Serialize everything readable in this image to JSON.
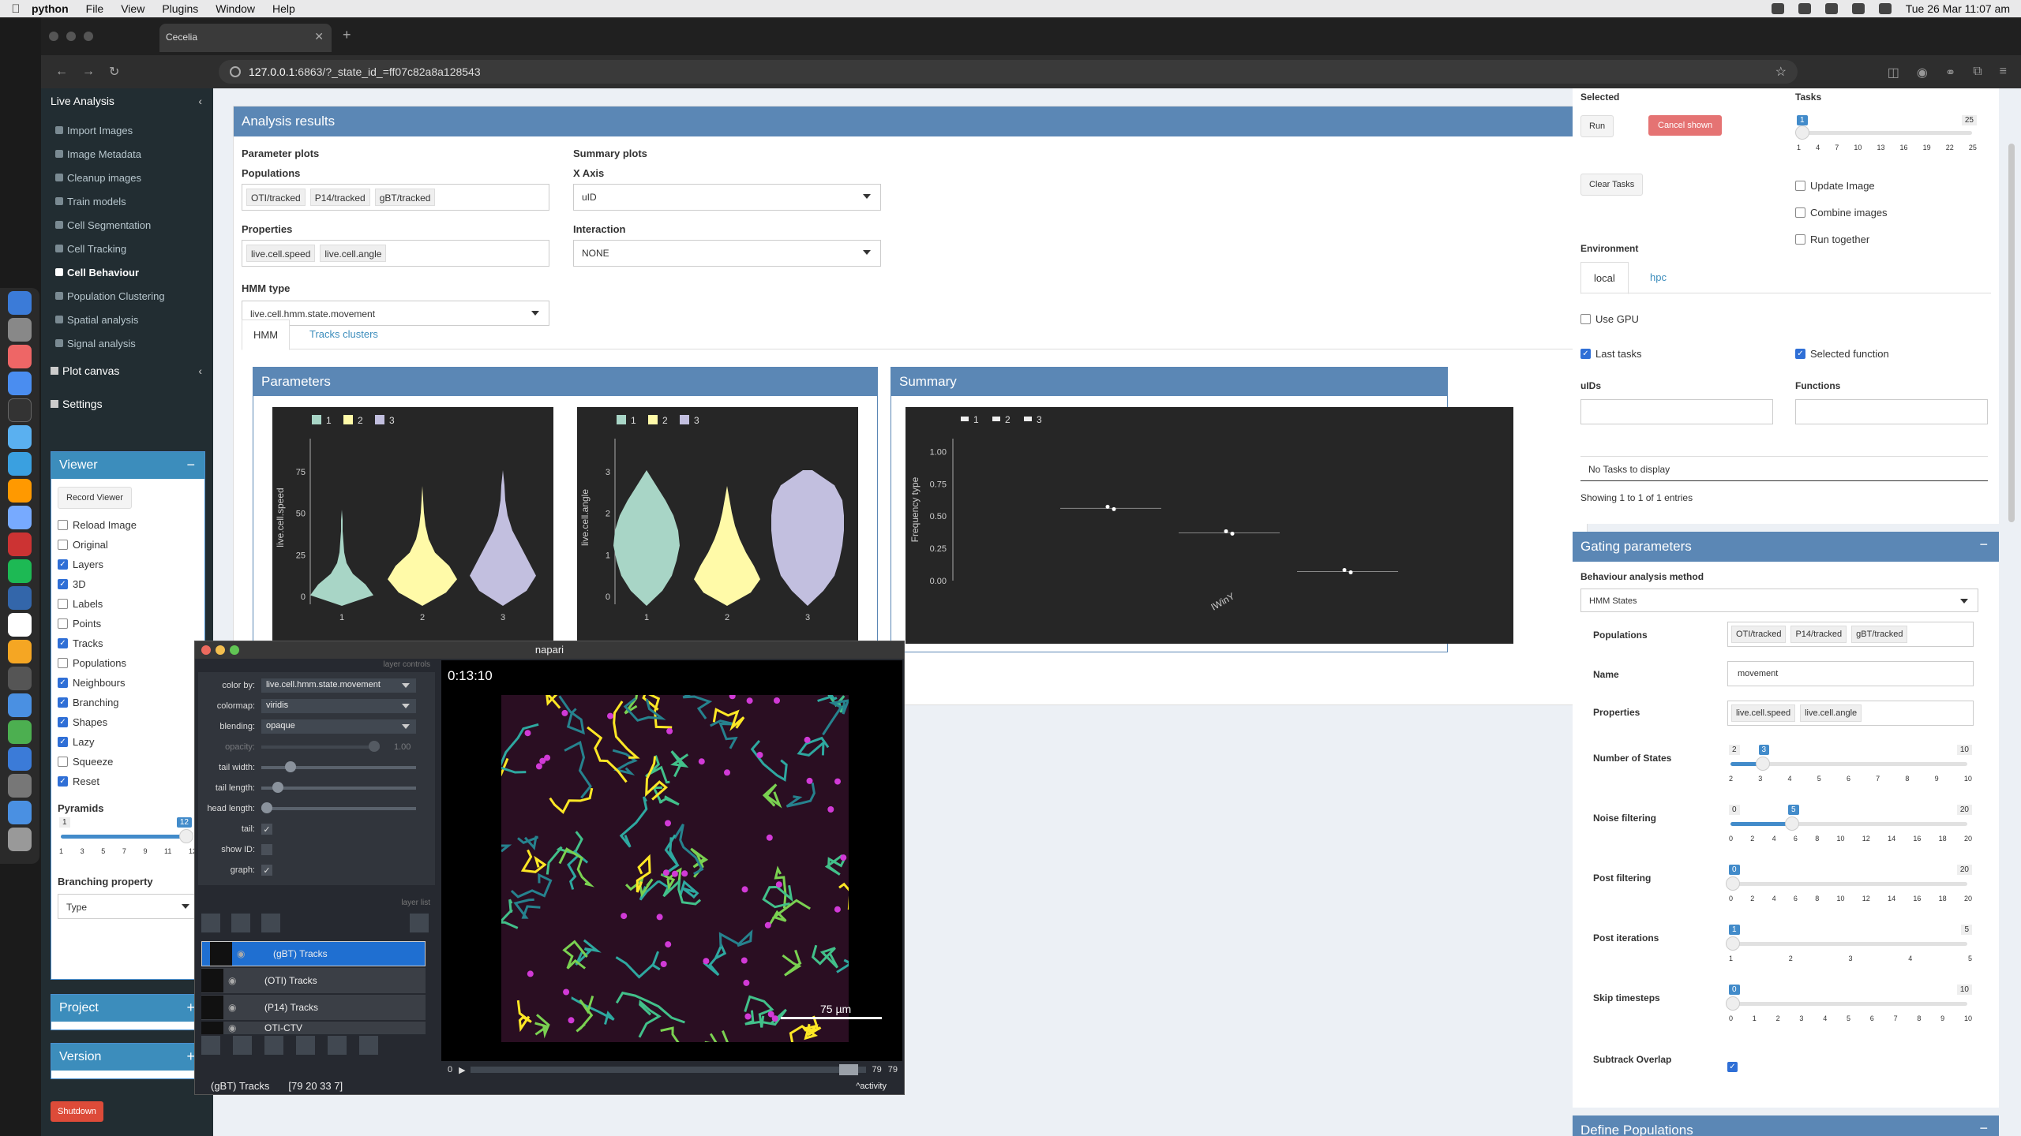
{
  "menubar": {
    "app": "python",
    "items": [
      "File",
      "View",
      "Plugins",
      "Window",
      "Help"
    ],
    "clock": "Tue 26 Mar  11:07 am"
  },
  "browser": {
    "tab_title": "Cecelia",
    "url_host": "127.0.0.1",
    "url_rest": ":6863/?_state_id_=ff07c82a8a128543"
  },
  "sidebar": {
    "live_analysis": "Live Analysis",
    "items": [
      "Import Images",
      "Image Metadata",
      "Cleanup images",
      "Train models",
      "Cell Segmentation",
      "Cell Tracking",
      "Cell Behaviour",
      "Population Clustering",
      "Spatial analysis",
      "Signal analysis"
    ],
    "plot_canvas": "Plot canvas",
    "settings": "Settings"
  },
  "viewer": {
    "title": "Viewer",
    "record": "Record Viewer",
    "options": [
      {
        "label": "Reload Image",
        "on": false
      },
      {
        "label": "Original",
        "on": false
      },
      {
        "label": "Layers",
        "on": true
      },
      {
        "label": "3D",
        "on": true
      },
      {
        "label": "Labels",
        "on": false
      },
      {
        "label": "Points",
        "on": false
      },
      {
        "label": "Tracks",
        "on": true
      },
      {
        "label": "Populations",
        "on": false
      },
      {
        "label": "Neighbours",
        "on": true
      },
      {
        "label": "Branching",
        "on": true
      },
      {
        "label": "Shapes",
        "on": true
      },
      {
        "label": "Lazy",
        "on": true
      },
      {
        "label": "Squeeze",
        "on": false
      },
      {
        "label": "Reset",
        "on": true
      }
    ],
    "pyramids_label": "Pyramids",
    "pyramids_min": "1",
    "pyramids_value": "12",
    "pyramids_ticks": [
      "1",
      "3",
      "5",
      "7",
      "9",
      "11",
      "12"
    ],
    "branching_label": "Branching property",
    "branching_value": "Type"
  },
  "project": "Project",
  "version": "Version",
  "shutdown": "Shutdown",
  "main": {
    "title": "Analysis results",
    "param_plots": "Parameter plots",
    "populations_label": "Populations",
    "populations": [
      "OTI/tracked",
      "P14/tracked",
      "gBT/tracked"
    ],
    "properties_label": "Properties",
    "properties": [
      "live.cell.speed",
      "live.cell.angle"
    ],
    "hmm_label": "HMM type",
    "hmm_value": "live.cell.hmm.state.movement",
    "summary_plots": "Summary plots",
    "xaxis_label": "X Axis",
    "xaxis_value": "uID",
    "interaction_label": "Interaction",
    "interaction_value": "NONE",
    "tabs": [
      "HMM",
      "Tracks clusters"
    ],
    "parameters_title": "Parameters",
    "summary_title": "Summary"
  },
  "chart_data": [
    {
      "type": "violin",
      "ylabel": "live.cell.speed",
      "categories": [
        "1",
        "2",
        "3"
      ],
      "legend": [
        "1",
        "2",
        "3"
      ],
      "yticks": [
        "0",
        "25",
        "50",
        "75"
      ],
      "colors": [
        "#a8d5c6",
        "#fffaa8",
        "#c2bfdf"
      ]
    },
    {
      "type": "violin",
      "ylabel": "live.cell.angle",
      "categories": [
        "1",
        "2",
        "3"
      ],
      "legend": [
        "1",
        "2",
        "3"
      ],
      "yticks": [
        "0",
        "1",
        "2",
        "3"
      ],
      "colors": [
        "#a8d5c6",
        "#fffaa8",
        "#c2bfdf"
      ]
    },
    {
      "type": "scatter",
      "ylabel": "Frequency type",
      "xlabel": "IWinY",
      "legend": [
        "1",
        "2",
        "3"
      ],
      "yticks": [
        "0.00",
        "0.25",
        "0.50",
        "0.75",
        "1.00"
      ],
      "series": [
        {
          "name": "1",
          "values": [
            0.56
          ]
        },
        {
          "name": "2",
          "values": [
            0.37
          ]
        },
        {
          "name": "3",
          "values": [
            0.07
          ]
        }
      ]
    }
  ],
  "tasks": {
    "selected_label": "Selected",
    "tasks_label": "Tasks",
    "run": "Run",
    "cancel": "Cancel shown",
    "clear": "Clear Tasks",
    "tasks_min": "1",
    "tasks_max": "25",
    "tasks_ticks": [
      "1",
      "4",
      "7",
      "10",
      "13",
      "16",
      "19",
      "22",
      "25"
    ],
    "opts": [
      {
        "label": "Update Image",
        "on": false
      },
      {
        "label": "Combine images",
        "on": false
      },
      {
        "label": "Run together",
        "on": false
      }
    ],
    "environment": "Environment",
    "env_tabs": [
      "local",
      "hpc"
    ],
    "use_gpu": "Use GPU",
    "last_tasks": "Last tasks",
    "selected_function": "Selected function",
    "uids": "uIDs",
    "functions": "Functions",
    "no_tasks": "No Tasks to display",
    "showing": "Showing 1 to 1 of 1 entries"
  },
  "gating": {
    "title": "Gating parameters",
    "method_label": "Behaviour analysis method",
    "method": "HMM States",
    "populations_label": "Populations",
    "populations": [
      "OTI/tracked",
      "P14/tracked",
      "gBT/tracked"
    ],
    "name_label": "Name",
    "name": "movement",
    "properties_label": "Properties",
    "properties": [
      "live.cell.speed",
      "live.cell.angle"
    ],
    "sliders": [
      {
        "label": "Number of States",
        "min": "2",
        "max": "10",
        "value": "3",
        "frac": 0.125,
        "ticks": [
          "2",
          "3",
          "4",
          "5",
          "6",
          "7",
          "8",
          "9",
          "10"
        ]
      },
      {
        "label": "Noise filtering",
        "min": "0",
        "max": "20",
        "value": "5",
        "frac": 0.25,
        "ticks": [
          "0",
          "2",
          "4",
          "6",
          "8",
          "10",
          "12",
          "14",
          "16",
          "18",
          "20"
        ]
      },
      {
        "label": "Post filtering",
        "min": "0",
        "max": "20",
        "value": "0",
        "frac": 0,
        "ticks": [
          "0",
          "2",
          "4",
          "6",
          "8",
          "10",
          "12",
          "14",
          "16",
          "18",
          "20"
        ]
      },
      {
        "label": "Post iterations",
        "min": "1",
        "max": "5",
        "value": "1",
        "frac": 0,
        "ticks": [
          "1",
          "2",
          "3",
          "4",
          "5"
        ]
      },
      {
        "label": "Skip timesteps",
        "min": "0",
        "max": "10",
        "value": "0",
        "frac": 0,
        "ticks": [
          "0",
          "1",
          "2",
          "3",
          "4",
          "5",
          "6",
          "7",
          "8",
          "9",
          "10"
        ]
      }
    ],
    "subtrack": "Subtrack Overlap"
  },
  "define_populations": "Define Populations",
  "napari": {
    "title": "napari",
    "layer_controls": "layer controls",
    "color_by": "live.cell.hmm.state.movement",
    "colormap": "viridis",
    "blending": "opaque",
    "keys": [
      "color by:",
      "colormap:",
      "blending:",
      "opacity:",
      "tail width:",
      "tail length:",
      "head length:",
      "tail:",
      "show ID:",
      "graph:"
    ],
    "opacity_val": "1.00",
    "layer_list": "layer list",
    "layers": [
      "(gBT) Tracks",
      "(OTI) Tracks",
      "(P14) Tracks",
      "OTI-CTV"
    ],
    "time": "0:13:10",
    "scale": "75 µm",
    "frame_start": "0",
    "frame_val": "79",
    "frame_max": "79",
    "status_layer": "(gBT) Tracks",
    "status_coords": "[79 20 33 7]",
    "activity": "activity"
  }
}
